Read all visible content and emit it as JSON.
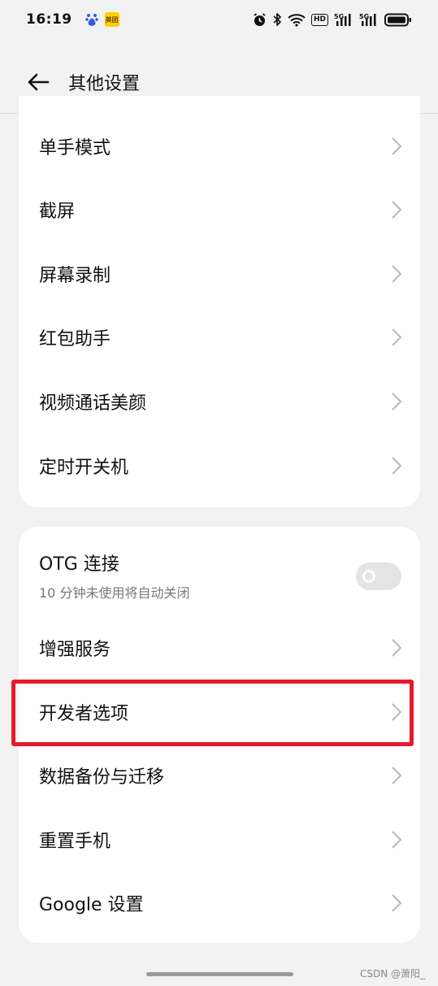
{
  "status_bar": {
    "time": "16:19",
    "icons_left": [
      "baidu-icon",
      "meituan-icon"
    ],
    "meituan_label": "美团",
    "icons_right": [
      "alarm-icon",
      "bluetooth-icon",
      "wifi-icon",
      "hd-icon",
      "signal-5g-1-icon",
      "signal-5g-2-icon",
      "battery-icon"
    ],
    "hd_label": "HD",
    "net_label_1": "5G",
    "net_label_2": "5G"
  },
  "header": {
    "title": "其他设置"
  },
  "group1": {
    "items": [
      {
        "label": "单手模式"
      },
      {
        "label": "截屏"
      },
      {
        "label": "屏幕录制"
      },
      {
        "label": "红包助手"
      },
      {
        "label": "视频通话美颜"
      },
      {
        "label": "定时开关机"
      }
    ]
  },
  "group2": {
    "otg": {
      "label": "OTG 连接",
      "sublabel": "10 分钟未使用将自动关闭",
      "enabled": false
    },
    "items": [
      {
        "label": "增强服务"
      },
      {
        "label": "开发者选项"
      },
      {
        "label": "数据备份与迁移"
      },
      {
        "label": "重置手机"
      },
      {
        "label": "Google 设置"
      }
    ]
  },
  "highlight_color": "#e8192c",
  "watermark": "CSDN @萧阳_"
}
